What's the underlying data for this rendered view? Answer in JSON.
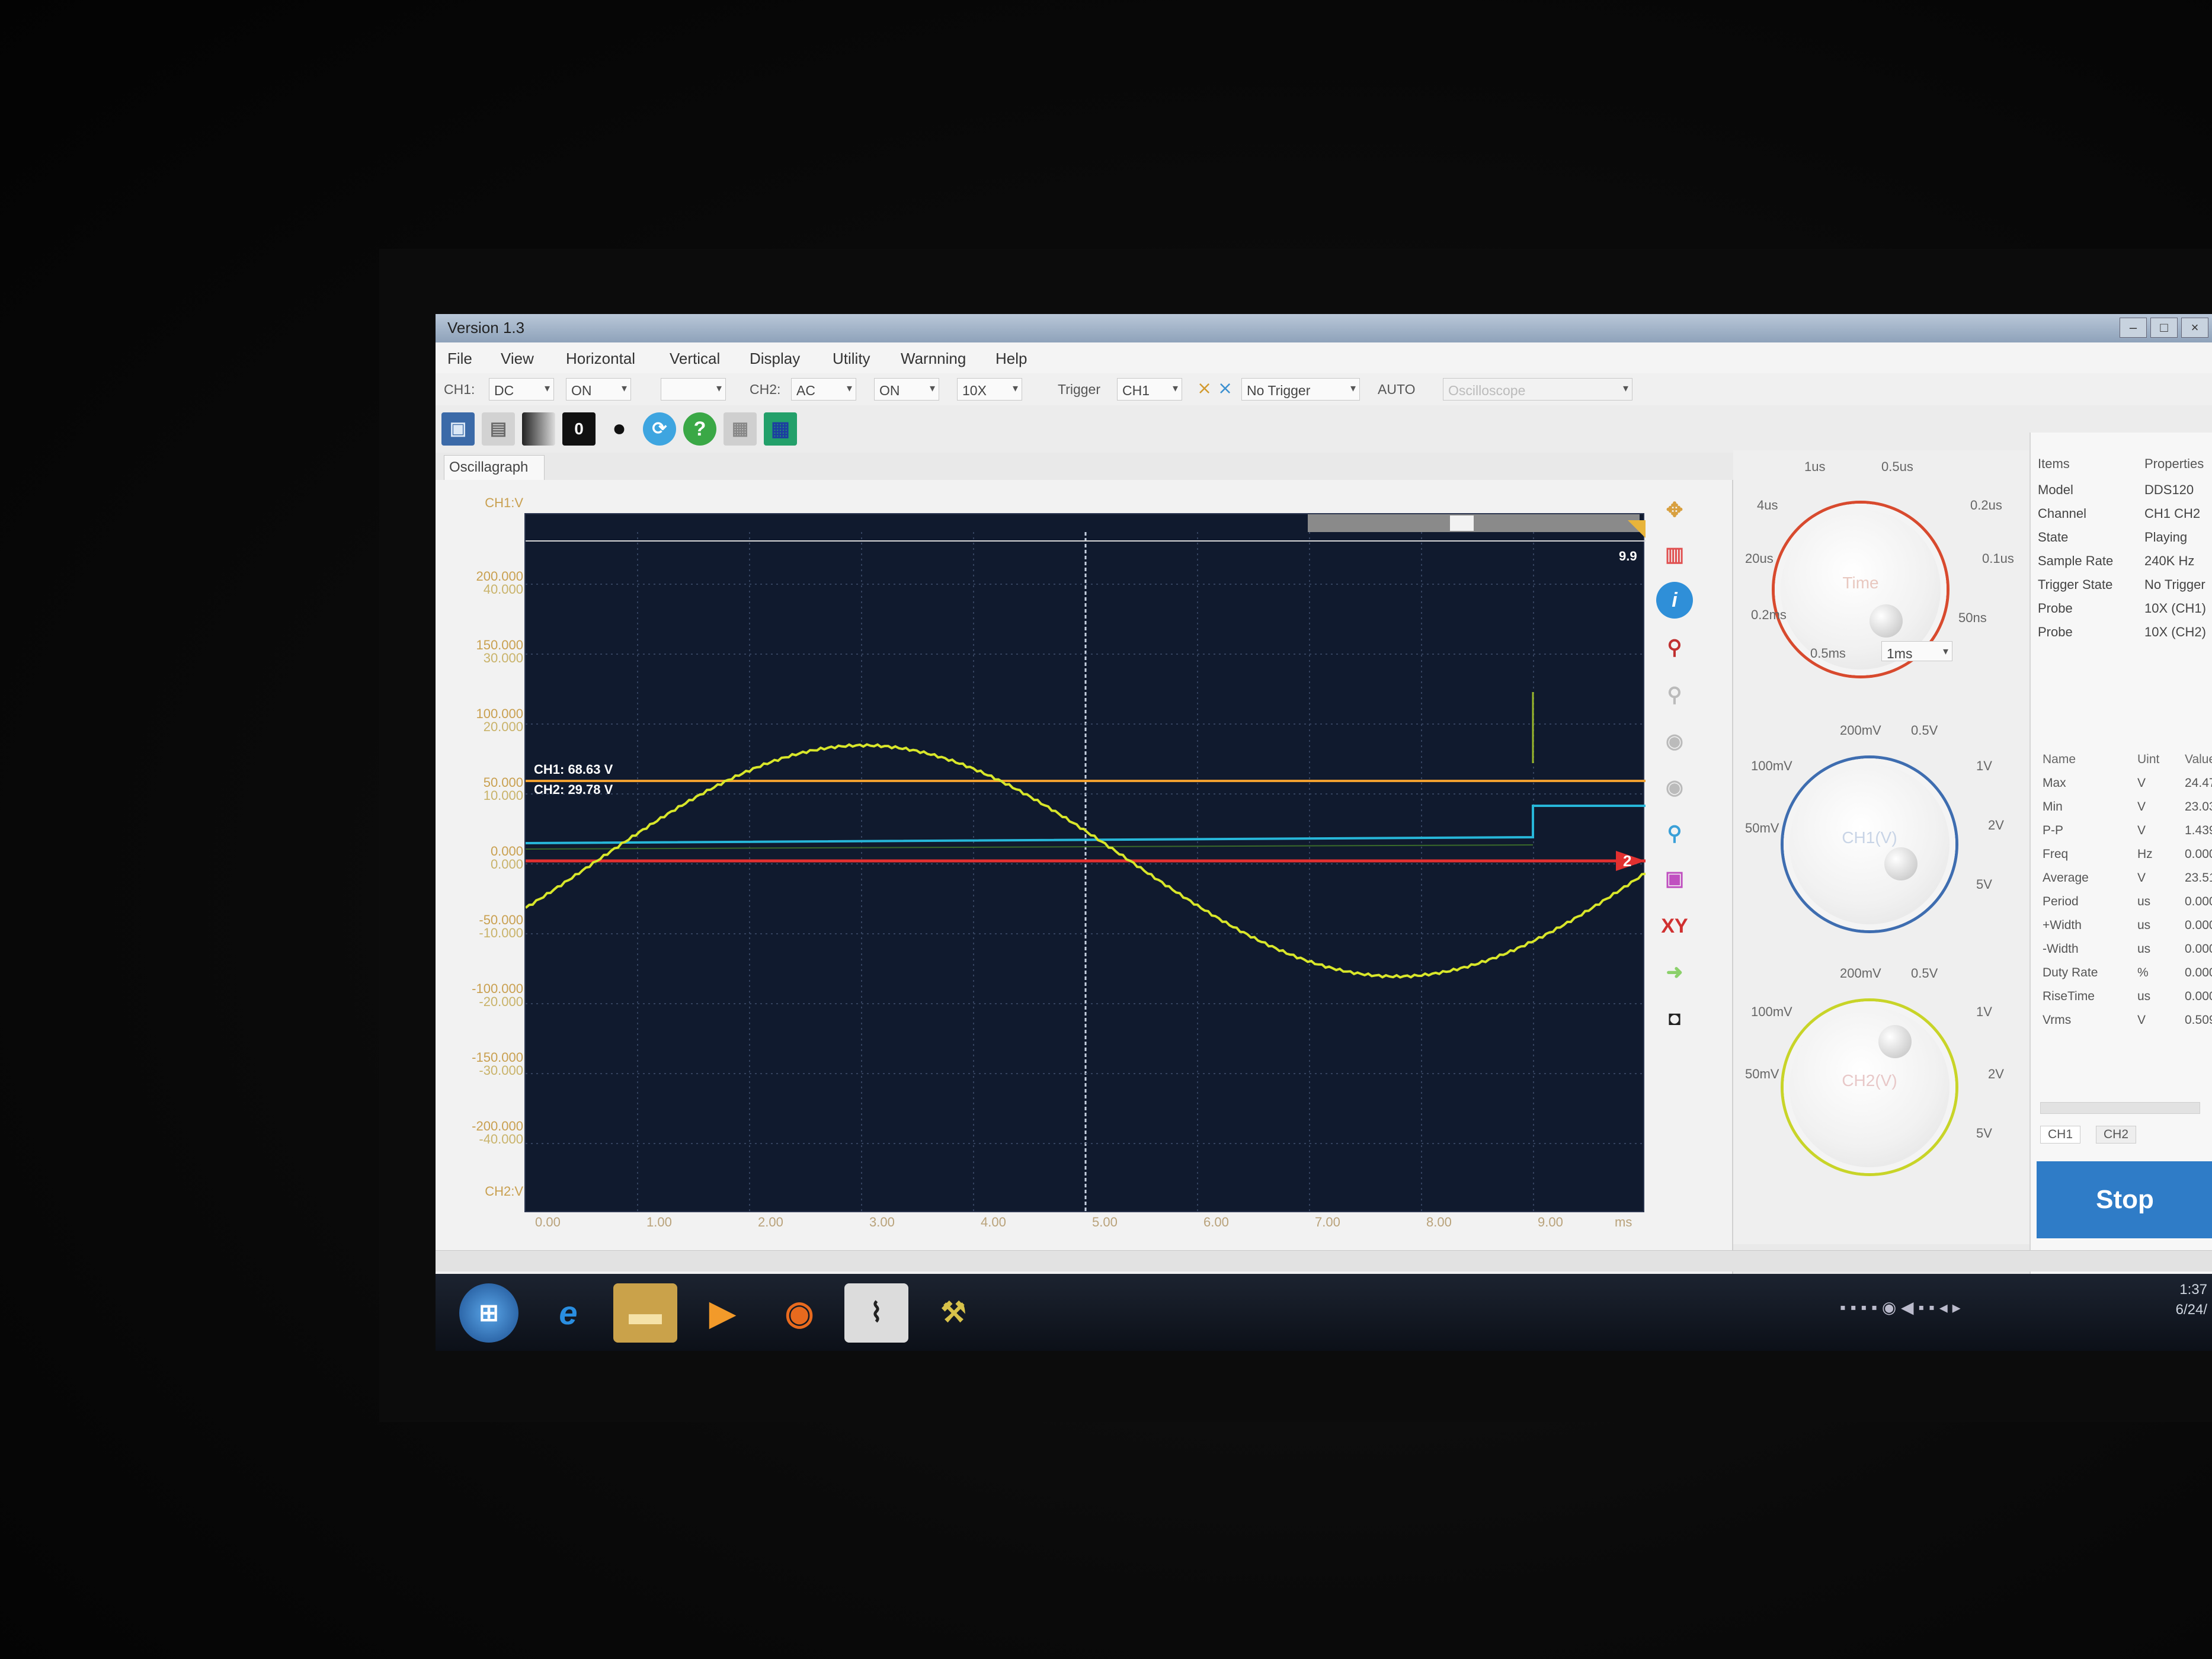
{
  "window": {
    "title": "Version 1.3"
  },
  "menu": [
    "File",
    "View",
    "Horizontal",
    "Vertical",
    "Display",
    "Utility",
    "Warnning",
    "Help"
  ],
  "settings": {
    "ch1_label": "CH1:",
    "ch1_coupling": "DC",
    "ch1_state": "ON",
    "ch1_probe": "",
    "ch2_label": "CH2:",
    "ch2_coupling": "AC",
    "ch2_state": "ON",
    "ch2_probe": "10X",
    "trigger_label": "Trigger",
    "trigger_source": "CH1",
    "trigger_state": "No Trigger",
    "trigger_mode": "AUTO",
    "device": "Oscilloscope"
  },
  "toolbar": {
    "zero_button": "0",
    "help_button": "?"
  },
  "tab": "Oscillagraph",
  "scope": {
    "ch1_axis_label": "CH1:V",
    "ch2_axis_label": "CH2:V",
    "y_ticks": [
      {
        "ch1": "200.000",
        "ch2": "40.000"
      },
      {
        "ch1": "150.000",
        "ch2": "30.000"
      },
      {
        "ch1": "100.000",
        "ch2": "20.000"
      },
      {
        "ch1": "50.000",
        "ch2": "10.000"
      },
      {
        "ch1": "0.000",
        "ch2": "0.000"
      },
      {
        "ch1": "-50.000",
        "ch2": "-10.000"
      },
      {
        "ch1": "-100.000",
        "ch2": "-20.000"
      },
      {
        "ch1": "-150.000",
        "ch2": "-30.000"
      },
      {
        "ch1": "-200.000",
        "ch2": "-40.000"
      }
    ],
    "x_ticks": [
      "0.00",
      "1.00",
      "2.00",
      "3.00",
      "4.00",
      "5.00",
      "6.00",
      "7.00",
      "8.00",
      "9.00"
    ],
    "x_unit": "ms",
    "ch1_cursor": "CH1: 68.63 V",
    "ch2_cursor": "CH2: 29.78 V",
    "top_right_value": "9.9",
    "ch2_marker": "2",
    "xy_label": "XY",
    "colors": {
      "ch1": "#d8e62a",
      "ch2": "#27b7d9",
      "cursor1": "#f0a030",
      "ground": "#e23030",
      "grid_bg": "#101a2e"
    }
  },
  "knobs": {
    "time": {
      "name": "Time",
      "labels": [
        "1us",
        "0.5us",
        "0.2us",
        "0.1us",
        "50ns",
        "4us",
        "20us",
        "0.2ms",
        "0.5ms"
      ],
      "select": "1ms"
    },
    "ch1": {
      "name": "CH1(V)",
      "labels": [
        "200mV",
        "0.5V",
        "1V",
        "2V",
        "5V",
        "100mV",
        "50mV"
      ]
    },
    "ch2": {
      "name": "CH2(V)",
      "labels": [
        "200mV",
        "0.5V",
        "1V",
        "2V",
        "5V",
        "100mV",
        "50mV"
      ]
    }
  },
  "properties": {
    "header": [
      "Items",
      "Properties"
    ],
    "rows": [
      [
        "Model",
        "DDS120"
      ],
      [
        "Channel",
        "CH1 CH2"
      ],
      [
        "State",
        "Playing"
      ],
      [
        "Sample Rate",
        "240K Hz"
      ],
      [
        "Trigger State",
        "No Trigger"
      ],
      [
        "Probe",
        "10X (CH1)"
      ],
      [
        "Probe",
        "10X (CH2)"
      ]
    ]
  },
  "measurements": {
    "header": [
      "Name",
      "Uint",
      "Value"
    ],
    "rows": [
      [
        "Max",
        "V",
        "24.47"
      ],
      [
        "Min",
        "V",
        "23.03"
      ],
      [
        "P-P",
        "V",
        "1.439"
      ],
      [
        "Freq",
        "Hz",
        "0.000"
      ],
      [
        "Average",
        "V",
        "23.51"
      ],
      [
        "Period",
        "us",
        "0.000"
      ],
      [
        "+Width",
        "us",
        "0.000"
      ],
      [
        "-Width",
        "us",
        "0.000"
      ],
      [
        "Duty Rate",
        "%",
        "0.000"
      ],
      [
        "RiseTime",
        "us",
        "0.000"
      ],
      [
        "Vrms",
        "V",
        "0.509"
      ]
    ],
    "tabs": [
      "CH1",
      "CH2"
    ]
  },
  "stop_button": "Stop",
  "clock": {
    "time": "1:37",
    "date": "6/24/"
  }
}
